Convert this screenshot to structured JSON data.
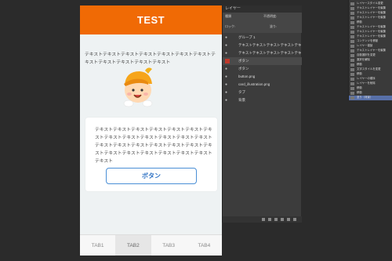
{
  "phone": {
    "title": "TEST",
    "intro_text": "テキストテキストテキストテキストテキストテキストテキストテキストテキストテキストテキストテキスト",
    "card_text": "テキストテキストテキストテキストテキストテキストテキストテキストテキストテキストテキストテキストテキストテキストテキストテキストテキストテキストテキストテキストテキストテキストテキストテキストテキストテキストテキスト",
    "button_label": "ボタン",
    "tabs": [
      {
        "label": "TAB1",
        "active": false
      },
      {
        "label": "TAB2",
        "active": true
      },
      {
        "label": "TAB3",
        "active": false
      },
      {
        "label": "TAB4",
        "active": false
      }
    ]
  },
  "layers_panel": {
    "title": "レイヤー",
    "filter_label": "種類",
    "opacity_label": "不透明度:",
    "fill_label": "塗り:",
    "lock_label": "ロック:",
    "layers": [
      {
        "name": "グループ 1"
      },
      {
        "name": "テキストテキストテキストテキストテキスト"
      },
      {
        "name": "テキストテキストテキストテキストテキスト"
      },
      {
        "name": "ボタン"
      },
      {
        "name": "ボタン"
      },
      {
        "name": "button.png"
      },
      {
        "name": "card_illustration.png"
      },
      {
        "name": "タブ"
      },
      {
        "name": "背景"
      }
    ]
  },
  "history_panel": {
    "items": [
      {
        "label": "レイヤースタイル変更"
      },
      {
        "label": "テキストレイヤーを編集"
      },
      {
        "label": "テキストレイヤーを編集"
      },
      {
        "label": "テキストレイヤーを編集"
      },
      {
        "label": "移動"
      },
      {
        "label": "テキストレイヤーを編集"
      },
      {
        "label": "テキストレイヤーを編集"
      },
      {
        "label": "テキストレイヤーを編集"
      },
      {
        "label": "コンテンツを移動"
      },
      {
        "label": "レイヤー複製"
      },
      {
        "label": "テキストレイヤーを編集"
      },
      {
        "label": "自動選択を変更"
      },
      {
        "label": "選択を解除"
      },
      {
        "label": "移動"
      },
      {
        "label": "文字スタイルを変更"
      },
      {
        "label": "移動"
      },
      {
        "label": "レイヤーの順序"
      },
      {
        "label": "レイヤーを削除"
      },
      {
        "label": "移動"
      },
      {
        "label": "移動"
      },
      {
        "label": "塗り（背景）"
      }
    ],
    "selected_index": 20
  },
  "colors": {
    "header": "#f06a05",
    "button_border": "#4a8fd6",
    "history_selected": "#5870a8"
  }
}
